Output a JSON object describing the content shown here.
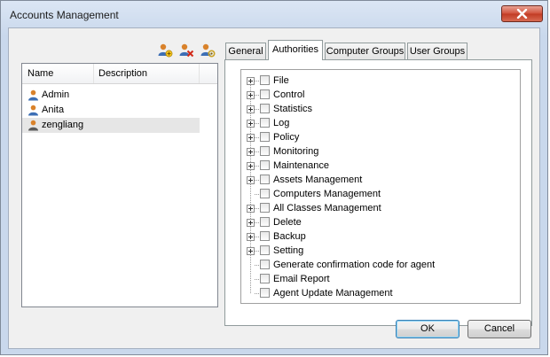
{
  "window": {
    "title": "Accounts Management"
  },
  "toolbar": {
    "icons": [
      "add-user-icon",
      "remove-user-icon",
      "user-properties-icon"
    ]
  },
  "accounts": {
    "columns": {
      "name": "Name",
      "description": "Description"
    },
    "rows": [
      {
        "name": "Admin",
        "description": ""
      },
      {
        "name": "Anita",
        "description": ""
      },
      {
        "name": "zengliang",
        "description": "",
        "selected": true
      }
    ]
  },
  "tabs": [
    {
      "label": "General"
    },
    {
      "label": "Authorities",
      "active": true
    },
    {
      "label": "Computer Groups"
    },
    {
      "label": "User Groups"
    }
  ],
  "authorities": [
    {
      "label": "File",
      "expandable": true
    },
    {
      "label": "Control",
      "expandable": true
    },
    {
      "label": "Statistics",
      "expandable": true
    },
    {
      "label": "Log",
      "expandable": true
    },
    {
      "label": "Policy",
      "expandable": true
    },
    {
      "label": "Monitoring",
      "expandable": true
    },
    {
      "label": "Maintenance",
      "expandable": true
    },
    {
      "label": "Assets Management",
      "expandable": true
    },
    {
      "label": "Computers Management",
      "expandable": false
    },
    {
      "label": "All Classes Management",
      "expandable": true
    },
    {
      "label": "Delete",
      "expandable": true
    },
    {
      "label": "Backup",
      "expandable": true
    },
    {
      "label": "Setting",
      "expandable": true
    },
    {
      "label": "Generate confirmation code for agent",
      "expandable": false
    },
    {
      "label": "Email Report",
      "expandable": false
    },
    {
      "label": "Agent Update Management",
      "expandable": false
    }
  ],
  "buttons": {
    "ok": "OK",
    "cancel": "Cancel"
  },
  "colors": {
    "close_red": "#c13a22",
    "selection_gray": "#e6e6e6",
    "default_button_border": "#3c7fb1"
  }
}
